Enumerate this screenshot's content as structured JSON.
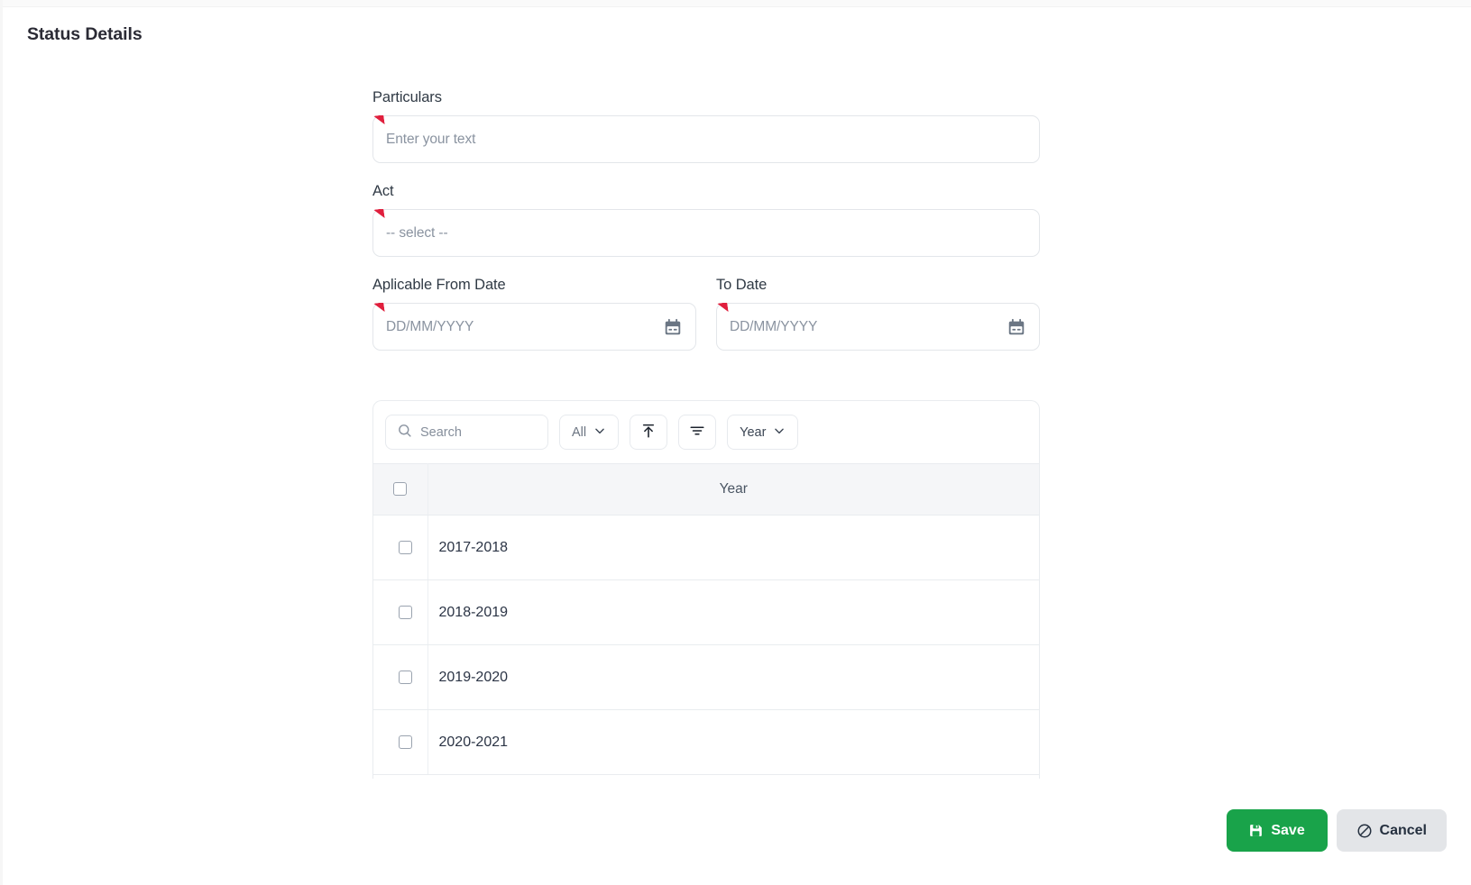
{
  "header": {
    "title": "Status Details"
  },
  "form": {
    "particulars": {
      "label": "Particulars",
      "placeholder": "Enter your text",
      "value": "",
      "required": true
    },
    "act": {
      "label": "Act",
      "placeholder": "-- select --",
      "value": "",
      "required": true
    },
    "from_date": {
      "label": "Aplicable From Date",
      "placeholder": "DD/MM/YYYY",
      "value": "",
      "required": true,
      "icon": "calendar-icon"
    },
    "to_date": {
      "label": "To Date",
      "placeholder": "DD/MM/YYYY",
      "value": "",
      "required": true,
      "icon": "calendar-icon"
    }
  },
  "table": {
    "toolbar": {
      "search_placeholder": "Search",
      "search_value": "",
      "search_icon": "search-icon",
      "all_filter_label": "All",
      "export_icon": "upload-icon",
      "filter_icon": "filter-icon",
      "column_select_label": "Year"
    },
    "columns": [
      {
        "key": "select",
        "label": ""
      },
      {
        "key": "year",
        "label": "Year"
      }
    ],
    "select_all_checked": false,
    "rows": [
      {
        "year": "2017-2018",
        "checked": false
      },
      {
        "year": "2018-2019",
        "checked": false
      },
      {
        "year": "2019-2020",
        "checked": false
      },
      {
        "year": "2020-2021",
        "checked": false
      }
    ]
  },
  "footer": {
    "save_label": "Save",
    "save_icon": "save-icon",
    "cancel_label": "Cancel",
    "cancel_icon": "ban-icon"
  },
  "colors": {
    "save_green": "#19a34a",
    "cancel_grey": "#e3e5e8",
    "required_red": "#e01f3d",
    "header_grey": "#f5f6f8",
    "border": "#e9ecef"
  }
}
